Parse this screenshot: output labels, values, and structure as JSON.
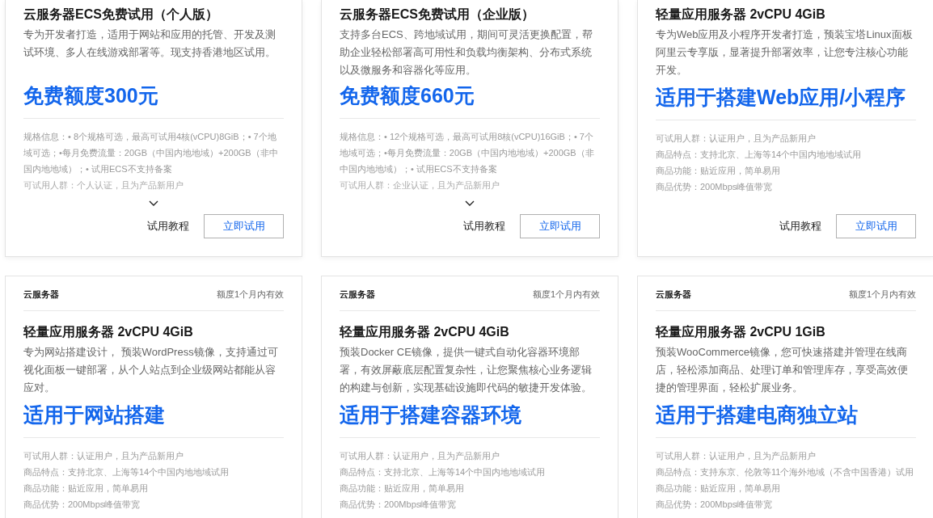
{
  "cards": [
    {
      "title": "云服务器ECS免费试用（个人版）",
      "description": "专为开发者打造，适用于网站和应用的托管、开发及测试环境、多人在线游戏部署等。现支持香港地区试用。",
      "highlight": "免费额度300元",
      "details": {
        "kind": "collapsible",
        "expanded": false,
        "lines": [
          "规格信息：• 8个规格可选，最高可试用4核(vCPU)8GiB；• 7个地域可选；•每月免费流量：20GB（中国内地地域）+200GB（非中国内地地域）；• 试用ECS不支持备案",
          "可试用人群：个人认证，且为产品新用户"
        ]
      },
      "actions": {
        "link": "试用教程",
        "button": "立即试用"
      }
    },
    {
      "title": "云服务器ECS免费试用（企业版）",
      "description": "支持多台ECS、跨地域试用，期间可灵活更换配置，帮助企业轻松部署高可用性和负载均衡架构、分布式系统以及微服务和容器化等应用。",
      "highlight": "免费额度660元",
      "details": {
        "kind": "collapsible",
        "expanded": false,
        "lines": [
          "规格信息：• 12个规格可选，最高可试用8核(vCPU)16GiB；• 7个地域可选；•每月免费流量：20GB（中国内地地域）+200GB（非中国内地地域）；• 试用ECS不支持备案",
          "可试用人群：企业认证，且为产品新用户"
        ]
      },
      "actions": {
        "link": "试用教程",
        "button": "立即试用"
      }
    },
    {
      "title": "轻量应用服务器 2vCPU 4GiB",
      "description": "专为Web应用及小程序开发者打造，预装宝塔Linux面板阿里云专享版，显著提升部署效率，让您专注核心功能开发。",
      "highlight": "适用于搭建Web应用/小程序",
      "details": {
        "kind": "list",
        "lines": [
          "可试用人群：认证用户，且为产品新用户",
          "商品特点：支持北京、上海等14个中国内地地域试用",
          "商品功能：贴近应用，简单易用",
          "商品优势：200Mbps峰值带宽"
        ]
      },
      "actions": {
        "link": "试用教程",
        "button": "立即试用"
      }
    },
    {
      "category": "云服务器",
      "validity": "额度1个月内有效",
      "title": "轻量应用服务器 2vCPU 4GiB",
      "description": "专为网站搭建设计， 预装WordPress镜像，支持通过可视化面板一键部署，从个人站点到企业级网站都能从容应对。",
      "highlight": "适用于网站搭建",
      "details": {
        "kind": "list",
        "lines": [
          "可试用人群：认证用户，且为产品新用户",
          "商品特点：支持北京、上海等14个中国内地地域试用",
          "商品功能：贴近应用，简单易用",
          "商品优势：200Mbps峰值带宽"
        ]
      }
    },
    {
      "category": "云服务器",
      "validity": "额度1个月内有效",
      "title": "轻量应用服务器 2vCPU 4GiB",
      "description": "预装Docker CE镜像，提供一键式自动化容器环境部署，有效屏蔽底层配置复杂性，让您聚焦核心业务逻辑的构建与创新，实现基础设施即代码的敏捷开发体验。",
      "highlight": "适用于搭建容器环境",
      "details": {
        "kind": "list",
        "lines": [
          "可试用人群：认证用户，且为产品新用户",
          "商品特点：支持北京、上海等14个中国内地地域试用",
          "商品功能：贴近应用，简单易用",
          "商品优势：200Mbps峰值带宽"
        ]
      }
    },
    {
      "category": "云服务器",
      "validity": "额度1个月内有效",
      "title": "轻量应用服务器 2vCPU 1GiB",
      "description": "预装WooCommerce镜像，您可快速搭建并管理在线商店，轻松添加商品、处理订单和管理库存，享受高效便捷的管理界面，轻松扩展业务。",
      "highlight": "适用于搭建电商独立站",
      "details": {
        "kind": "list",
        "lines": [
          "可试用人群：认证用户，且为产品新用户",
          "商品特点：支持东京、伦敦等11个海外地域（不含中国香港）试用",
          "商品功能：贴近应用，简单易用",
          "商品优势：200Mbps峰值带宽"
        ]
      }
    }
  ]
}
